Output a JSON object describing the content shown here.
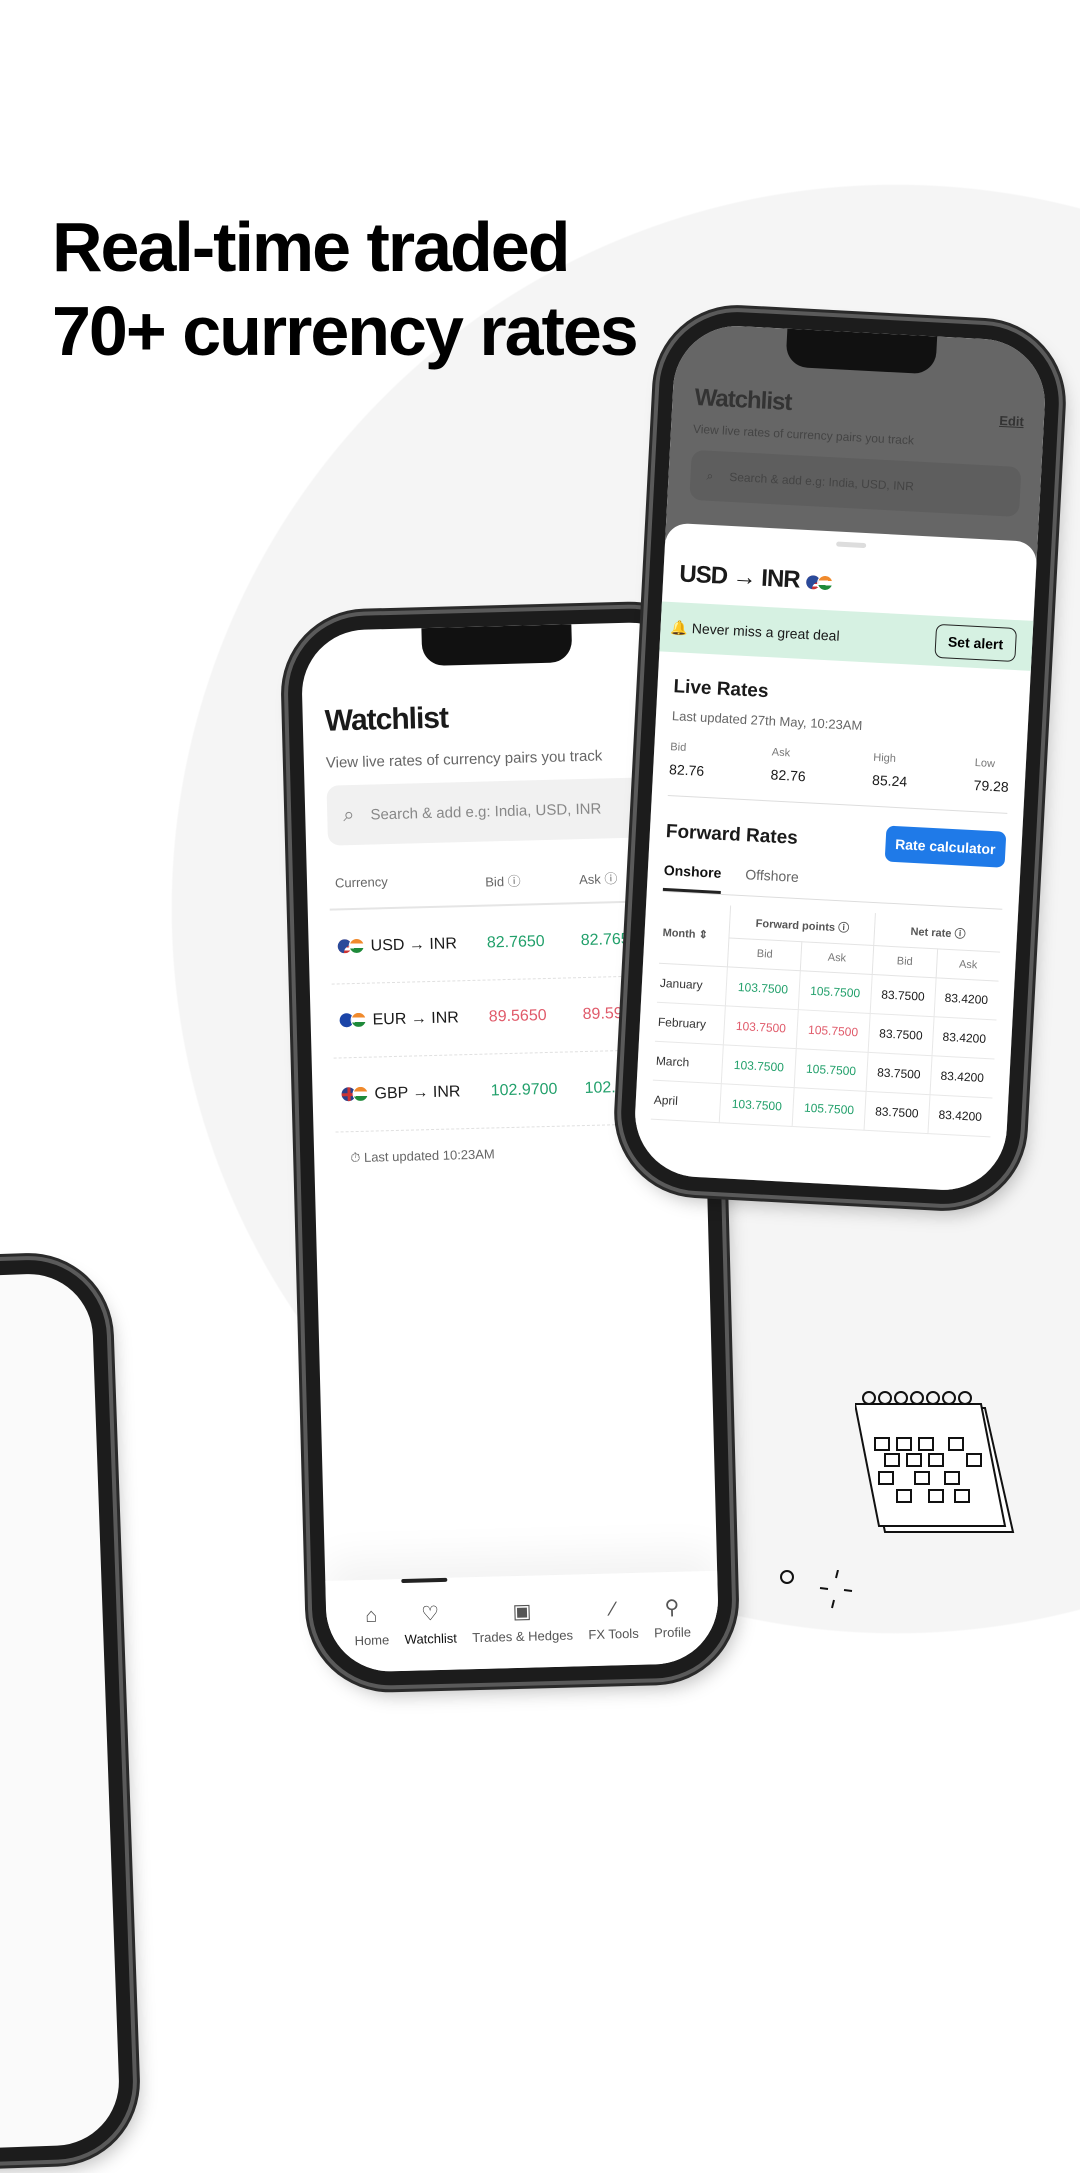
{
  "headline": {
    "line1": "Real-time traded",
    "line2": "70+ currency rates"
  },
  "colors": {
    "green": "#22a06b",
    "red": "#e05a6a",
    "accent": "#1f7ae8",
    "alert_bg": "#d6f1e2"
  },
  "watchlist": {
    "title": "Watchlist",
    "edit": "Edit",
    "subtitle": "View live rates of currency pairs you track",
    "search_placeholder": "Search & add e.g: India, USD, INR",
    "columns": {
      "currency": "Currency",
      "bid": "Bid",
      "ask": "Ask"
    },
    "rows": [
      {
        "pair": "USD → INR",
        "bid": "82.7650",
        "ask": "82.7650",
        "trend": "up"
      },
      {
        "pair": "EUR → INR",
        "bid": "89.5650",
        "ask": "89.5910",
        "trend": "down"
      },
      {
        "pair": "GBP → INR",
        "bid": "102.9700",
        "ask": "102.980",
        "trend": "up"
      }
    ],
    "last_updated": "Last updated 10:23AM"
  },
  "nav": [
    {
      "label": "Home",
      "icon": "home-icon"
    },
    {
      "label": "Watchlist",
      "icon": "heart-icon",
      "active": true
    },
    {
      "label": "Trades & Hedges",
      "icon": "briefcase-chart-icon"
    },
    {
      "label": "FX Tools",
      "icon": "magic-wand-icon"
    },
    {
      "label": "Profile",
      "icon": "user-icon"
    }
  ],
  "detail": {
    "pair": "USD → INR",
    "alert_text": "Never miss a great deal",
    "alert_button": "Set alert",
    "live_title": "Live Rates",
    "live_updated": "Last updated 27th May, 10:23AM",
    "stats": [
      {
        "label": "Bid",
        "value": "82.76"
      },
      {
        "label": "Ask",
        "value": "82.76"
      },
      {
        "label": "High",
        "value": "85.24"
      },
      {
        "label": "Low",
        "value": "79.28"
      }
    ],
    "forward_title": "Forward Rates",
    "calc_button": "Rate calculator",
    "tabs": [
      {
        "label": "Onshore",
        "active": true
      },
      {
        "label": "Offshore"
      }
    ],
    "table": {
      "month": "Month",
      "forward_points": "Forward points",
      "net_rate": "Net rate",
      "bid": "Bid",
      "ask": "Ask",
      "rows": [
        {
          "month": "January",
          "fp_bid": "103.7500",
          "fp_ask": "105.7500",
          "nr_bid": "83.7500",
          "nr_ask": "83.4200",
          "trend": "up"
        },
        {
          "month": "February",
          "fp_bid": "103.7500",
          "fp_ask": "105.7500",
          "nr_bid": "83.7500",
          "nr_ask": "83.4200",
          "trend": "down"
        },
        {
          "month": "March",
          "fp_bid": "103.7500",
          "fp_ask": "105.7500",
          "nr_bid": "83.7500",
          "nr_ask": "83.4200",
          "trend": "up"
        },
        {
          "month": "April",
          "fp_bid": "103.7500",
          "fp_ask": "105.7500",
          "nr_bid": "83.7500",
          "nr_ask": "83.4200",
          "trend": "up"
        }
      ]
    }
  }
}
